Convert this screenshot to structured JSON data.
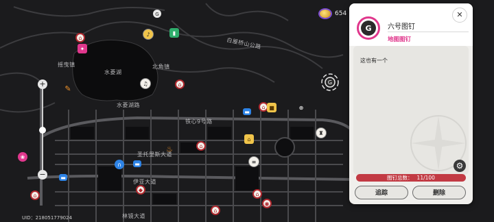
{
  "map": {
    "road_labels": {
      "baiwu_bridge_highway": "白屋桥山公路",
      "shuiling_lake": "水菱湖",
      "beijiao_town": "北角镇",
      "shuiling_lake_road": "水菱湖路",
      "tiexin_9_road": "铁心9号路",
      "sheng_tuoli_si_avenue": "圣托里斯大道",
      "yiya_avenue": "伊亚大道",
      "linjing_avenue": "林镜大道",
      "yaokongshi_town": "摇曳镇"
    },
    "uid": "UID：218051779024"
  },
  "currency": {
    "amount": "654"
  },
  "panel": {
    "pin_glyph": "G",
    "title": "六号图钉",
    "subtitle": "地图图钉",
    "close_glyph": "✕",
    "note": "这也有一个",
    "settings_glyph": "⚙",
    "count_label": "图钉总数：",
    "count_value": "11/100",
    "track_label": "追踪",
    "delete_label": "删除"
  },
  "colors": {
    "accent_pink": "#e0378c",
    "count_bar_red": "#c23a43",
    "panel_bg": "#f0efec"
  }
}
